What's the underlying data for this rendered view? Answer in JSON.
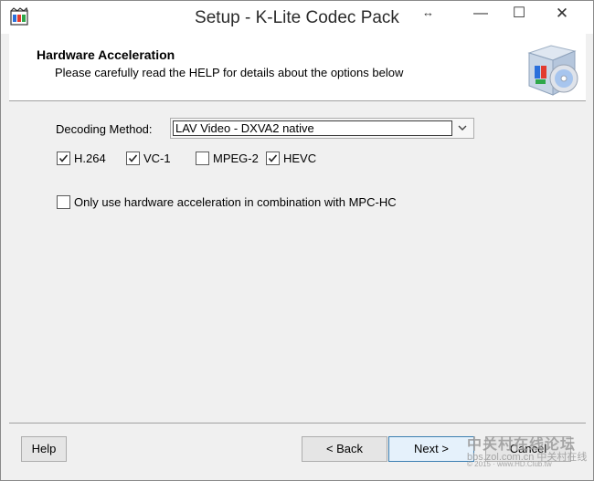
{
  "window": {
    "title": "Setup - K-Lite Codec Pack",
    "title_extra": "↔",
    "controls": {
      "minimize": "—",
      "maximize": "☐",
      "close": "✕"
    }
  },
  "header": {
    "title": "Hardware Acceleration",
    "subtitle": "Please carefully read the HELP for details about the options below"
  },
  "decoding": {
    "label": "Decoding Method:",
    "selected": "LAV Video - DXVA2 native"
  },
  "codecs": [
    {
      "label": "H.264",
      "checked": true
    },
    {
      "label": "VC-1",
      "checked": true
    },
    {
      "label": "MPEG-2",
      "checked": false
    },
    {
      "label": "HEVC",
      "checked": true
    }
  ],
  "mpc_option": {
    "label": "Only use hardware acceleration in combination with MPC-HC",
    "checked": false
  },
  "buttons": {
    "help": "Help",
    "back": "< Back",
    "next": "Next >",
    "cancel": "Cancel"
  },
  "watermark": {
    "line1": "中关村在线论坛",
    "line2": "bbs.zol.com.cn 中关村在线",
    "line3": "© 2015 · www.HD.Club.tw"
  }
}
